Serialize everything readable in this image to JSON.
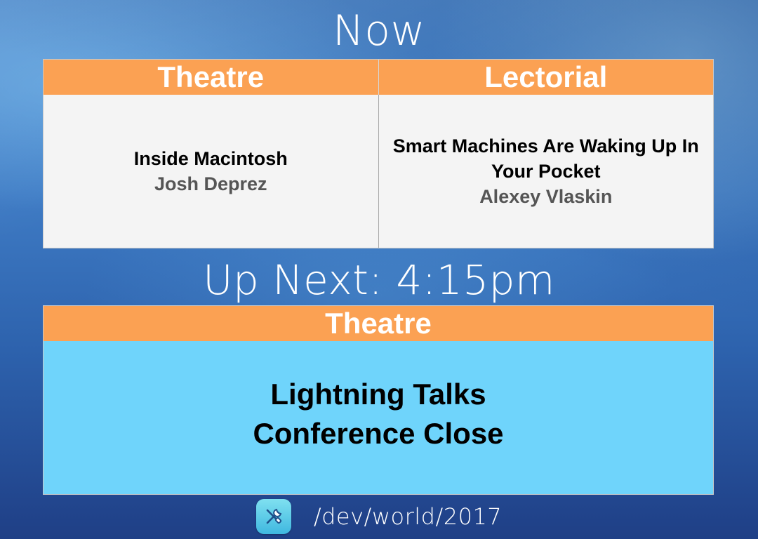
{
  "now": {
    "heading": "Now",
    "rooms": [
      {
        "name": "Theatre",
        "title": "Inside Macintosh",
        "speaker": "Josh Deprez"
      },
      {
        "name": "Lectorial",
        "title": "Smart Machines Are Waking Up In Your Pocket",
        "speaker": "Alexey Vlaskin"
      }
    ]
  },
  "up_next": {
    "heading": "Up Next: 4:15pm",
    "room": "Theatre",
    "title_lines": [
      "Lightning Talks",
      "Conference Close"
    ]
  },
  "footer": {
    "icon": "tools-icon",
    "text": "/dev/world/2017"
  },
  "colors": {
    "header_orange": "#fba153",
    "panel_grey": "#f4f4f4",
    "panel_blue": "#6fd4fb",
    "speaker_grey": "#555555"
  }
}
